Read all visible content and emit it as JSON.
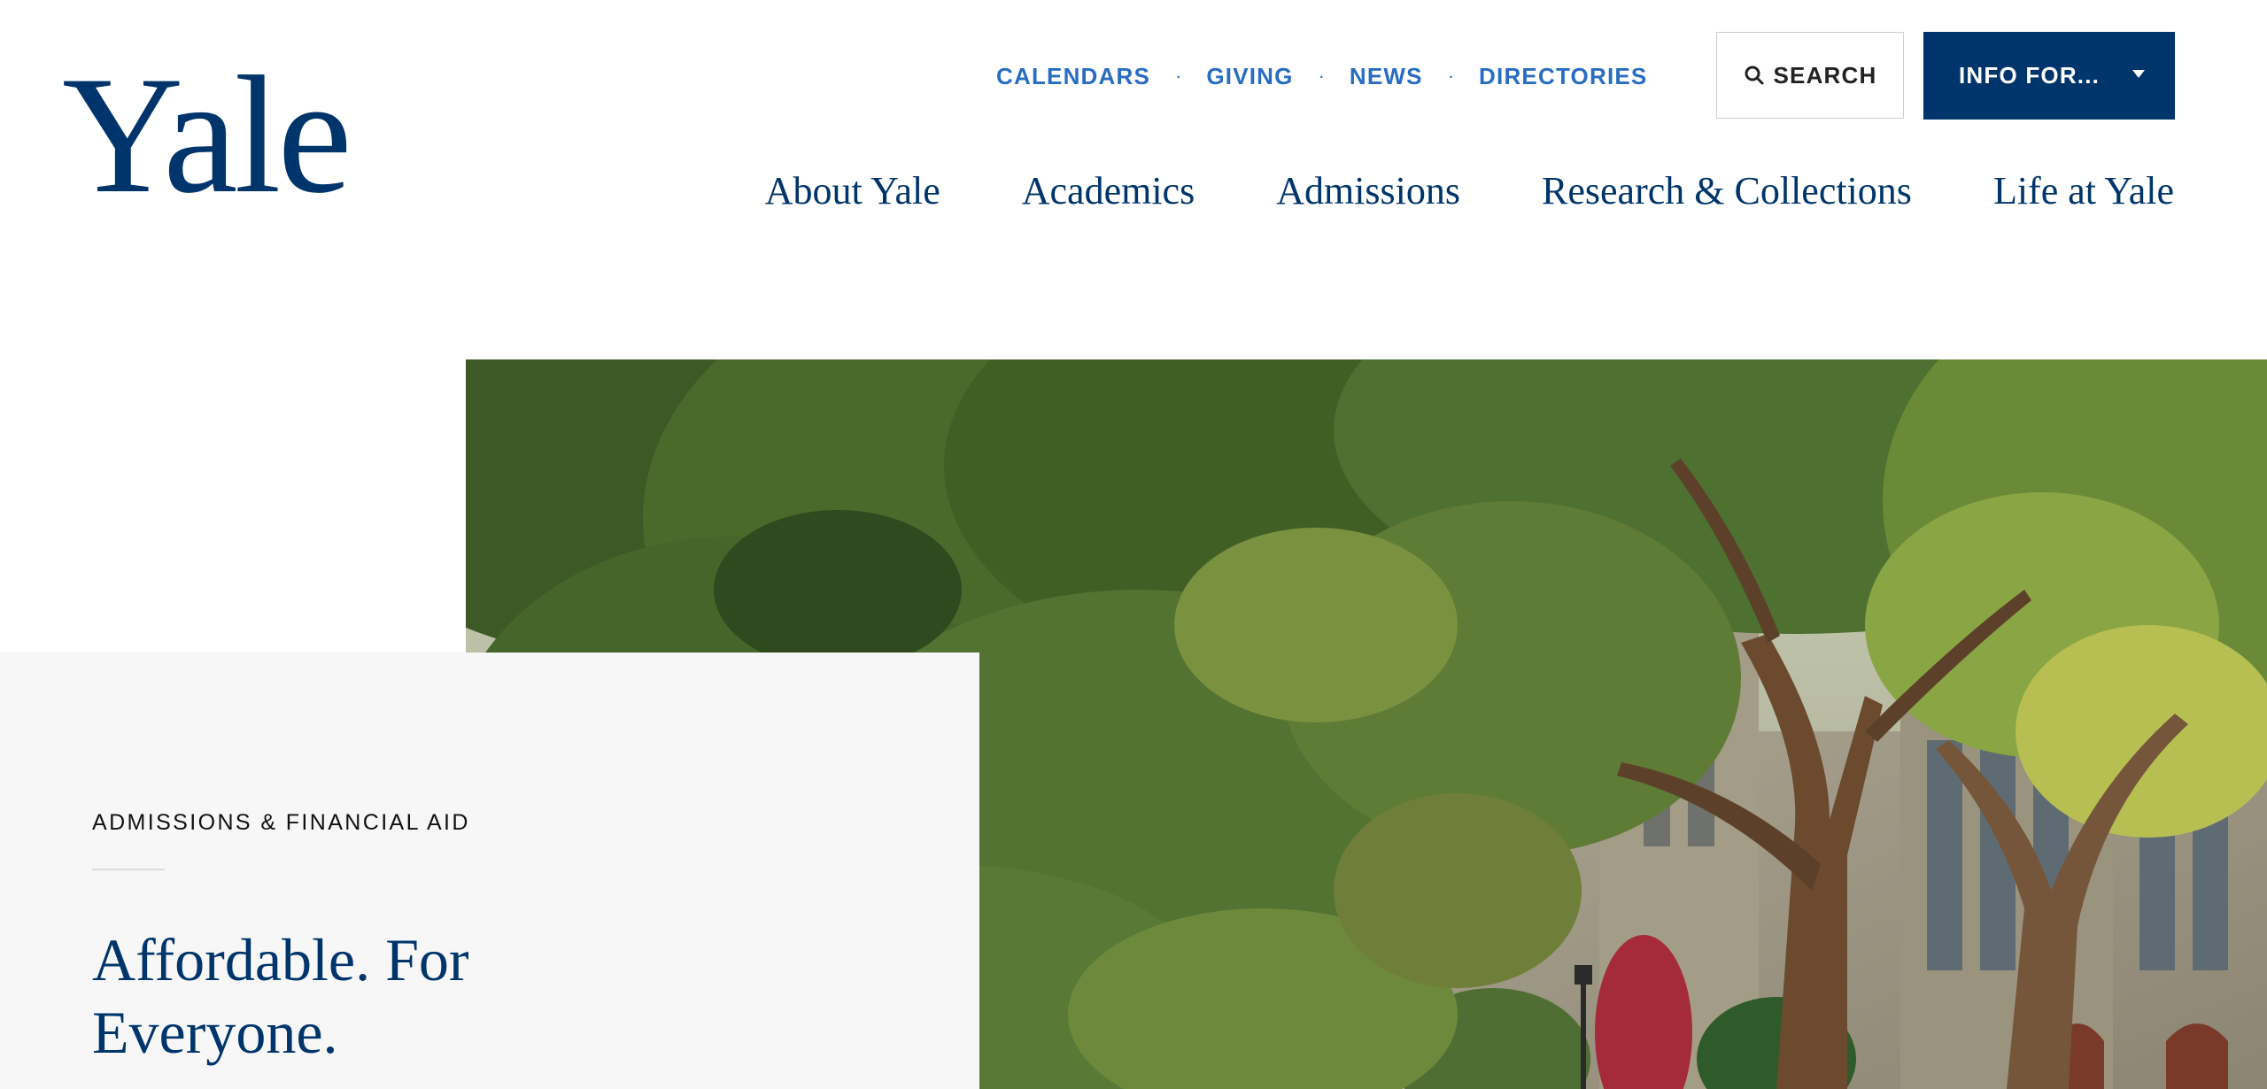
{
  "header": {
    "logo_text": "Yale",
    "utility_links": [
      "CALENDARS",
      "GIVING",
      "NEWS",
      "DIRECTORIES"
    ],
    "separator": "·",
    "search_label": "SEARCH",
    "info_label": "INFO FOR...",
    "main_nav": [
      "About Yale",
      "Academics",
      "Admissions",
      "Research & Collections",
      "Life at Yale"
    ]
  },
  "hero": {
    "image": "campus-trees-photo"
  },
  "card": {
    "eyebrow": "ADMISSIONS & FINANCIAL AID",
    "headline": "Affordable. For Everyone."
  },
  "colors": {
    "brand_navy": "#00356b",
    "link_blue": "#286dc0",
    "card_bg": "#f7f7f7"
  },
  "icons": {
    "search": "search-icon",
    "dropdown": "caret-down-icon"
  }
}
